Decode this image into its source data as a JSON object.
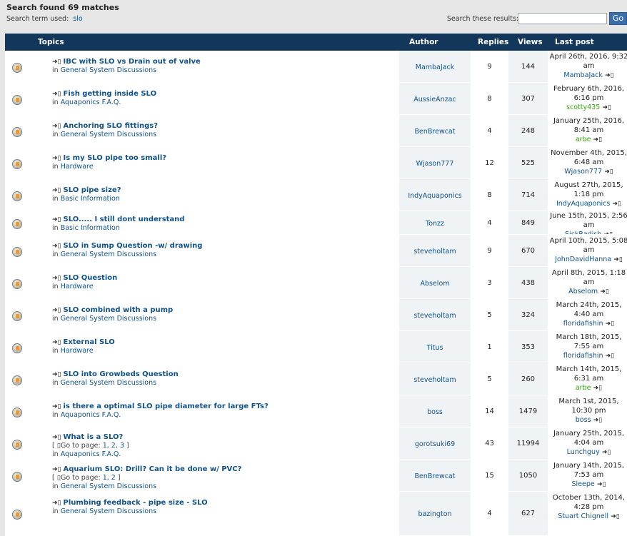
{
  "search": {
    "title": "Search found 69 matches",
    "term_label": "Search term used:",
    "term": "slo",
    "results_label": "Search these results:",
    "go_label": "Go"
  },
  "columns": {
    "topics": "Topics",
    "author": "Author",
    "replies": "Replies",
    "views": "Views",
    "last_post": "Last post"
  },
  "goto_label": "Go to page:",
  "topics": [
    {
      "title": "IBC with SLO vs Drain out of valve",
      "forum": "General System Discussions",
      "author": "MambaJack",
      "replies": "9",
      "views": "144",
      "last_date": "April 26th, 2016, 9:32 am",
      "last_by": "MambaJack",
      "green": false
    },
    {
      "title": "Fish getting inside SLO",
      "forum": "Aquaponics F.A.Q.",
      "author": "AussieAnzac",
      "replies": "8",
      "views": "307",
      "last_date": "February 6th, 2016, 6:16 pm",
      "last_by": "scotty435",
      "green": true
    },
    {
      "title": "Anchoring SLO fittings?",
      "forum": "General System Discussions",
      "author": "BenBrewcat",
      "replies": "4",
      "views": "248",
      "last_date": "January 25th, 2016, 8:41 am",
      "last_by": "arbe",
      "green": true
    },
    {
      "title": "Is my SLO pipe too small?",
      "forum": "Hardware",
      "author": "Wjason777",
      "replies": "12",
      "views": "525",
      "last_date": "November 4th, 2015, 6:48 am",
      "last_by": "Wjason777",
      "green": false
    },
    {
      "title": "SLO pipe size?",
      "forum": "Basic Information",
      "author": "IndyAquaponics",
      "replies": "8",
      "views": "714",
      "last_date": "August 27th, 2015, 1:18 pm",
      "last_by": "IndyAquaponics",
      "green": false
    },
    {
      "title": "SLO..... I still dont understand",
      "forum": "Basic Information",
      "author": "Tonzz",
      "replies": "4",
      "views": "849",
      "last_date": "June 15th, 2015, 2:56 am",
      "last_by": "SickRadish",
      "green": false
    },
    {
      "title": "SLO in Sump Question -w/ drawing",
      "forum": "General System Discussions",
      "author": "steveholtam",
      "replies": "9",
      "views": "670",
      "last_date": "April 10th, 2015, 5:08 am",
      "last_by": "JohnDavidHanna",
      "green": false
    },
    {
      "title": "SLO Question",
      "forum": "Hardware",
      "author": "Abselom",
      "replies": "3",
      "views": "438",
      "last_date": "April 8th, 2015, 1:18 am",
      "last_by": "Abselom",
      "green": false
    },
    {
      "title": "SLO combined with a pump",
      "forum": "General System Discussions",
      "author": "steveholtam",
      "replies": "5",
      "views": "324",
      "last_date": "March 24th, 2015, 4:40 am",
      "last_by": "floridafishin",
      "green": false
    },
    {
      "title": "External SLO",
      "forum": "Hardware",
      "author": "Titus",
      "replies": "1",
      "views": "353",
      "last_date": "March 18th, 2015, 7:55 am",
      "last_by": "floridafishin",
      "green": false
    },
    {
      "title": "SLO into Growbeds Question",
      "forum": "General System Discussions",
      "author": "steveholtam",
      "replies": "5",
      "views": "260",
      "last_date": "March 14th, 2015, 6:31 am",
      "last_by": "arbe",
      "green": true
    },
    {
      "title": "is there a optimal SLO pipe diameter for large FTs?",
      "forum": "Aquaponics F.A.Q.",
      "author": "boss",
      "replies": "14",
      "views": "1479",
      "last_date": "March 1st, 2015, 10:30 pm",
      "last_by": "boss",
      "green": false
    },
    {
      "title": "What is a SLO?",
      "forum": "Aquaponics F.A.Q.",
      "author": "gorotsuki69",
      "replies": "43",
      "views": "11994",
      "last_date": "January 25th, 2015, 4:04 am",
      "last_by": "Lunchguy",
      "green": false,
      "pages": "1, 2, 3"
    },
    {
      "title": "Aquarium SLO: Drill? Can it be done w/ PVC?",
      "forum": "General System Discussions",
      "author": "BenBrewcat",
      "replies": "15",
      "views": "1050",
      "last_date": "January 14th, 2015, 7:53 am",
      "last_by": "Sleepe",
      "green": false,
      "pages": "1, 2"
    },
    {
      "title": "Plumbing feedback - pipe size - SLO",
      "forum": "General System Discussions",
      "author": "bazington",
      "replies": "4",
      "views": "627",
      "last_date": "October 13th, 2014, 4:28 pm",
      "last_by": "Stuart Chignell",
      "green": false
    }
  ]
}
